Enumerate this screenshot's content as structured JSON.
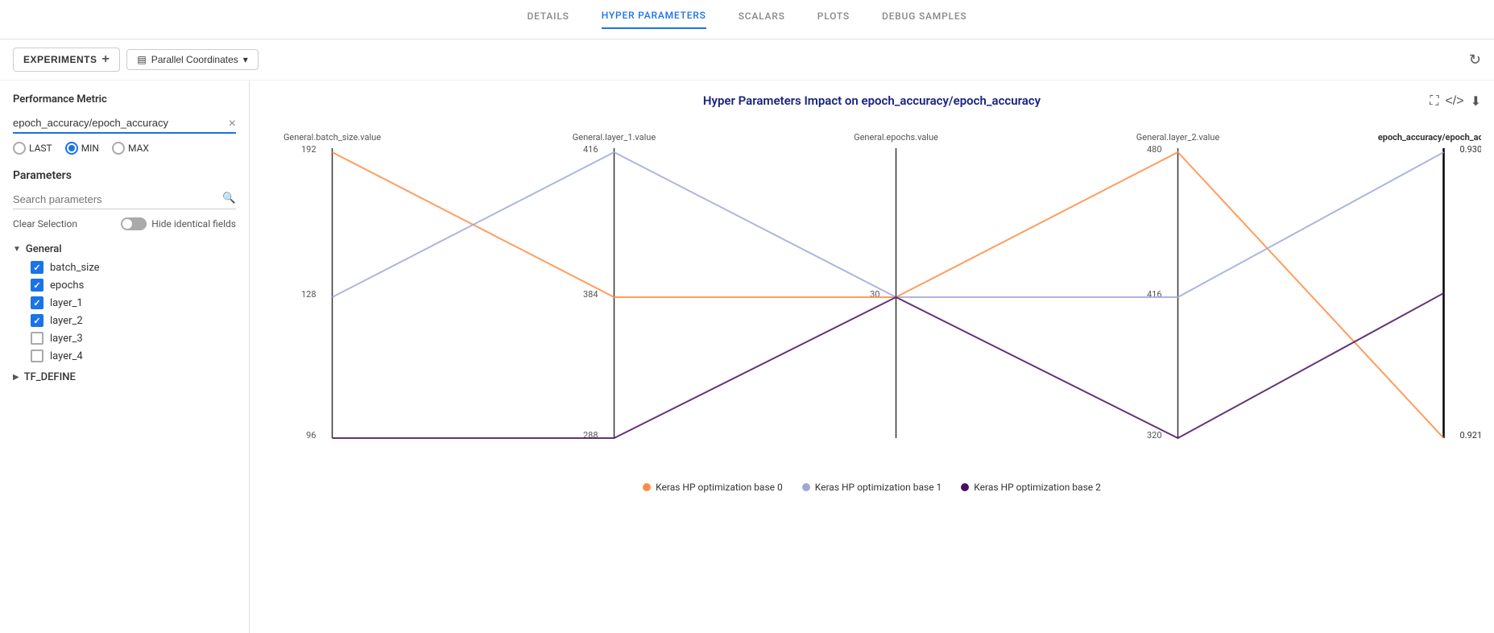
{
  "nav": {
    "tabs": [
      {
        "id": "details",
        "label": "DETAILS",
        "active": false
      },
      {
        "id": "hyper-parameters",
        "label": "HYPER PARAMETERS",
        "active": true
      },
      {
        "id": "scalars",
        "label": "SCALARS",
        "active": false
      },
      {
        "id": "plots",
        "label": "PLOTS",
        "active": false
      },
      {
        "id": "debug-samples",
        "label": "DEBUG SAMPLES",
        "active": false
      }
    ]
  },
  "toolbar": {
    "experiments_label": "EXPERIMENTS",
    "parallel_label": "Parallel Coordinates",
    "add_icon": "+",
    "dropdown_icon": "▾"
  },
  "sidebar": {
    "performance_metric_title": "Performance Metric",
    "performance_metric_value": "epoch_accuracy/epoch_accuracy",
    "radio_options": [
      {
        "id": "last",
        "label": "LAST",
        "selected": false,
        "color": "default"
      },
      {
        "id": "min",
        "label": "MIN",
        "selected": true,
        "color": "blue"
      },
      {
        "id": "max",
        "label": "MAX",
        "selected": false,
        "color": "default"
      }
    ],
    "parameters_title": "Parameters",
    "search_placeholder": "Search parameters",
    "clear_selection_label": "Clear Selection",
    "hide_identical_label": "Hide identical fields",
    "groups": [
      {
        "id": "general",
        "label": "General",
        "expanded": true,
        "items": [
          {
            "id": "batch_size",
            "label": "batch_size",
            "checked": true
          },
          {
            "id": "epochs",
            "label": "epochs",
            "checked": true
          },
          {
            "id": "layer_1",
            "label": "layer_1",
            "checked": true
          },
          {
            "id": "layer_2",
            "label": "layer_2",
            "checked": true
          },
          {
            "id": "layer_3",
            "label": "layer_3",
            "checked": false
          },
          {
            "id": "layer_4",
            "label": "layer_4",
            "checked": false
          }
        ]
      },
      {
        "id": "tf_define",
        "label": "TF_DEFINE",
        "expanded": false,
        "items": []
      }
    ]
  },
  "chart": {
    "title": "Hyper Parameters Impact on epoch_accuracy/epoch_accuracy",
    "axes": [
      {
        "id": "batch_size",
        "label": "General.batch_size.value",
        "min": 96,
        "max": 192,
        "mid": 128
      },
      {
        "id": "layer_1",
        "label": "General.layer_1.value",
        "min": 288,
        "max": 416,
        "mid": 384
      },
      {
        "id": "epochs",
        "label": "General.epochs.value",
        "min": 30,
        "max": 30,
        "mid": 30
      },
      {
        "id": "layer_2",
        "label": "General.layer_2.value",
        "min": 320,
        "max": 480,
        "mid": 416
      },
      {
        "id": "accuracy",
        "label": "epoch_accuracy/epoch_accuracy",
        "min": "0.9212333559989929",
        "max": "0.9300000071525574"
      }
    ],
    "series": [
      {
        "id": "base0",
        "color": "#ff8c42",
        "name": "Keras HP optimization base 0"
      },
      {
        "id": "base1",
        "color": "#9fa8da",
        "name": "Keras HP optimization base 1"
      },
      {
        "id": "base2",
        "color": "#4a1060",
        "name": "Keras HP optimization base 2"
      }
    ]
  },
  "legend": [
    {
      "label": "Keras HP optimization base 0",
      "color": "#ff8c42"
    },
    {
      "label": "Keras HP optimization base 1",
      "color": "#9fa8da"
    },
    {
      "label": "Keras HP optimization base 2",
      "color": "#4a1060"
    }
  ]
}
